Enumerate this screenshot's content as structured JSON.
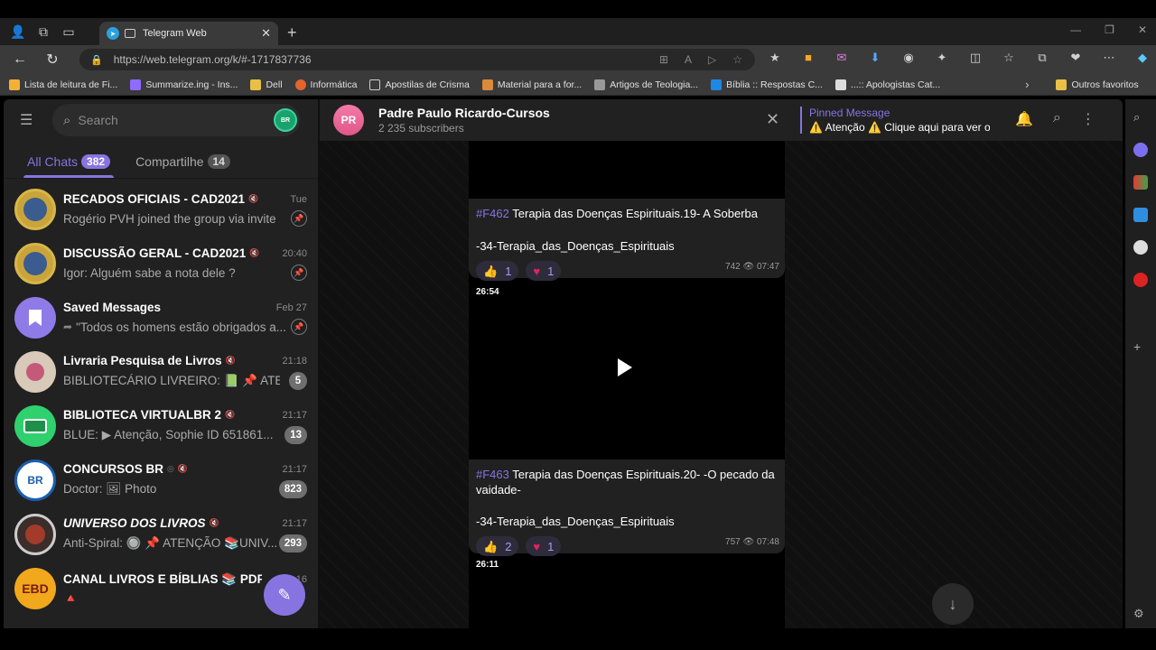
{
  "browser": {
    "tab_title": "Telegram Web",
    "url": "https://web.telegram.org/k/#-1717837736",
    "bookmarks": [
      "Lista de leitura de Fi...",
      "Summarize.ing - Ins...",
      "Dell",
      "Informática",
      "Apostilas de Crisma",
      "Material para a for...",
      "Artigos de Teologia...",
      "Bíblia :: Respostas C...",
      "...:: Apologistas Cat...",
      "Outros favoritos"
    ]
  },
  "left": {
    "search_placeholder": "Search",
    "avatar_label": "BR",
    "folders": [
      {
        "label": "All Chats",
        "count": "382"
      },
      {
        "label": "Compartilhe",
        "count": "14"
      }
    ],
    "chats": [
      {
        "name": "RECADOS OFICIAIS - CAD2021",
        "time": "Tue",
        "msg": "Rogério PVH joined the group via invite l...",
        "badge": "",
        "avatar": ""
      },
      {
        "name": "DISCUSSÃO GERAL - CAD2021",
        "time": "20:40",
        "msg": "Igor: Alguém sabe a nota dele ?",
        "badge": "",
        "avatar": ""
      },
      {
        "name": "Saved Messages",
        "time": "Feb 27",
        "msg": "\"Todos os homens estão obrigados a...",
        "badge": "",
        "avatar": ""
      },
      {
        "name": "Livraria Pesquisa de Livros",
        "time": "21:18",
        "msg": "BIBLIOTECÁRIO LIVREIRO: 📗 📌 ATEN...",
        "badge": "5",
        "avatar": ""
      },
      {
        "name": "BIBLIOTECA VIRTUALBR 2",
        "time": "21:17",
        "msg": "BLUE: ▶ Atenção, Sophie ID 651861...",
        "badge": "13",
        "avatar": ""
      },
      {
        "name": "CONCURSOS BR",
        "time": "21:17",
        "msg": "Doctor: 🖼 Photo",
        "badge": "823",
        "avatar": "BR"
      },
      {
        "name": "UNIVERSO DOS LIVROS",
        "time": "21:17",
        "msg": "Anti-Spiral: 🔘 📌 ATENÇÃO 📚UNIV...",
        "badge": "293",
        "avatar": ""
      },
      {
        "name": "CANAL LIVROS E BÍBLIAS 📚 PDF ...",
        "time": "21:16",
        "msg": "🔺",
        "badge": "",
        "avatar": "EBD"
      }
    ]
  },
  "chat": {
    "avatar": "PR",
    "title": "Padre Paulo Ricardo-Cursos",
    "subtitle": "2 235 subscribers",
    "pinned_title": "Pinned Message",
    "pinned_text": "⚠️ Atenção ⚠️ Clique aqui para ver o...",
    "messages": [
      {
        "tag": "#F462",
        "title": "Terapia das Doenças Espirituais.19- A Soberba",
        "line2": "-34-Terapia_das_Doenças_Espirituais",
        "like": "1",
        "heart": "1",
        "views": "742",
        "time": "07:47"
      },
      {
        "duration": "26:54",
        "tag": "#F463",
        "title": "Terapia das Doenças Espirituais.20- -O pecado da vaidade-",
        "line2": "-34-Terapia_das_Doenças_Espirituais",
        "like": "2",
        "heart": "1",
        "views": "757",
        "time": "07:48"
      },
      {
        "duration": "26:11"
      }
    ]
  }
}
